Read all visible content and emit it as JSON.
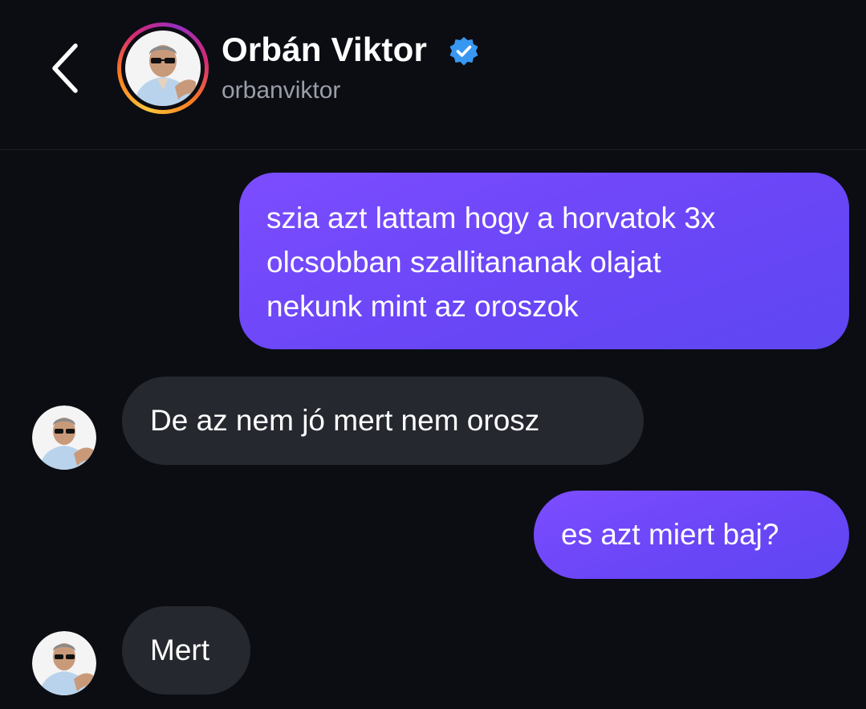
{
  "header": {
    "back_icon": "chevron-left-icon",
    "avatar_icon": "profile-photo",
    "name": "Orbán Viktor",
    "verified_icon": "verified-badge-icon",
    "handle": "orbanviktor"
  },
  "colors": {
    "background": "#0b0d13",
    "sent_bubble": "#6a46f7",
    "received_bubble": "#262830",
    "verified_badge": "#3897f0",
    "handle_text": "#9a9ea8"
  },
  "messages": [
    {
      "direction": "sent",
      "lines": [
        "szia azt lattam hogy a horvatok 3x",
        "olcsobban szallitananak olajat",
        "nekunk mint az oroszok"
      ]
    },
    {
      "direction": "received",
      "text": "De az nem jó mert nem orosz"
    },
    {
      "direction": "sent",
      "text": "es azt miert baj?"
    },
    {
      "direction": "received",
      "text": "Mert"
    }
  ]
}
